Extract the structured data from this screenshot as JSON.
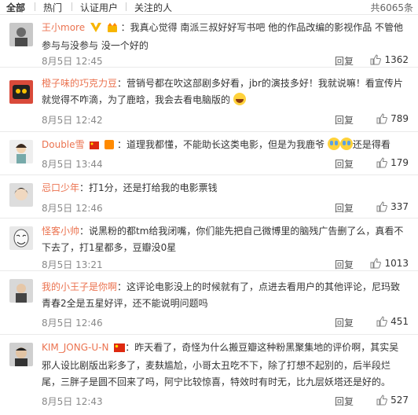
{
  "filter_tabs": [
    "全部",
    "热门",
    "认证用户",
    "关注的人"
  ],
  "total_count": "共6065条",
  "reply_label": "回复",
  "comments": [
    {
      "user": "王小more",
      "text": "：我真心觉得 南派三叔好好写书吧 他的作品改编的影视作品 不管他参与与没参与 没一个好的",
      "time": "8月5日 12:45",
      "likes": "1362"
    },
    {
      "user": "橙子味的巧克力豆",
      "text": "：营销号都在吹这部剧多好看，jbr的演技多好！我就说嘛！看宣传片就觉得不咋滴，为了鹿晗，我会去看电脑版的",
      "time": "8月5日 12:42",
      "likes": "789"
    },
    {
      "user": "Double雪",
      "text": "：道理我都懂，不能助长这类电影，但是为我鹿爷",
      "text2": "还是得看",
      "time": "8月5日 13:44",
      "likes": "179"
    },
    {
      "user": "忌口少年",
      "text": "：打1分，还是打给我的电影票钱",
      "time": "8月5日 12:46",
      "likes": "337"
    },
    {
      "user": "怪客小帅",
      "text": "：说黑粉的都tm给我闭嘴，你们能先把自己微博里的脑残广告删了么，真看不下去了，打1星都多，豆瓣没0星",
      "time": "8月5日 13:21",
      "likes": "1013"
    },
    {
      "user": "我的小王子是你啊",
      "text": "：这评论电影没上的时候就有了，点进去看用户的其他评论，尼玛致青春2全是五星好评，还不能说明问题吗",
      "time": "8月5日 12:46",
      "likes": "451"
    },
    {
      "user": "KIM_JONG-U-N",
      "text": "：昨天看了，奇怪为什么搬豆瓣这种粉黑聚集地的评价啊，其实吴邪人设比剧版出彩多了，麦麸尴尬，小哥太丑吃不下，除了打想不起别的，后半段烂尾，三胖子是圆不回来了吗，阿宁比较惊喜，特效时有时无，比九层妖塔还是好的。",
      "time": "8月5日 12:43",
      "likes": "527"
    }
  ],
  "colors": {
    "username": "#eb7350",
    "meta": "#888888",
    "divider": "#eaeaea"
  }
}
